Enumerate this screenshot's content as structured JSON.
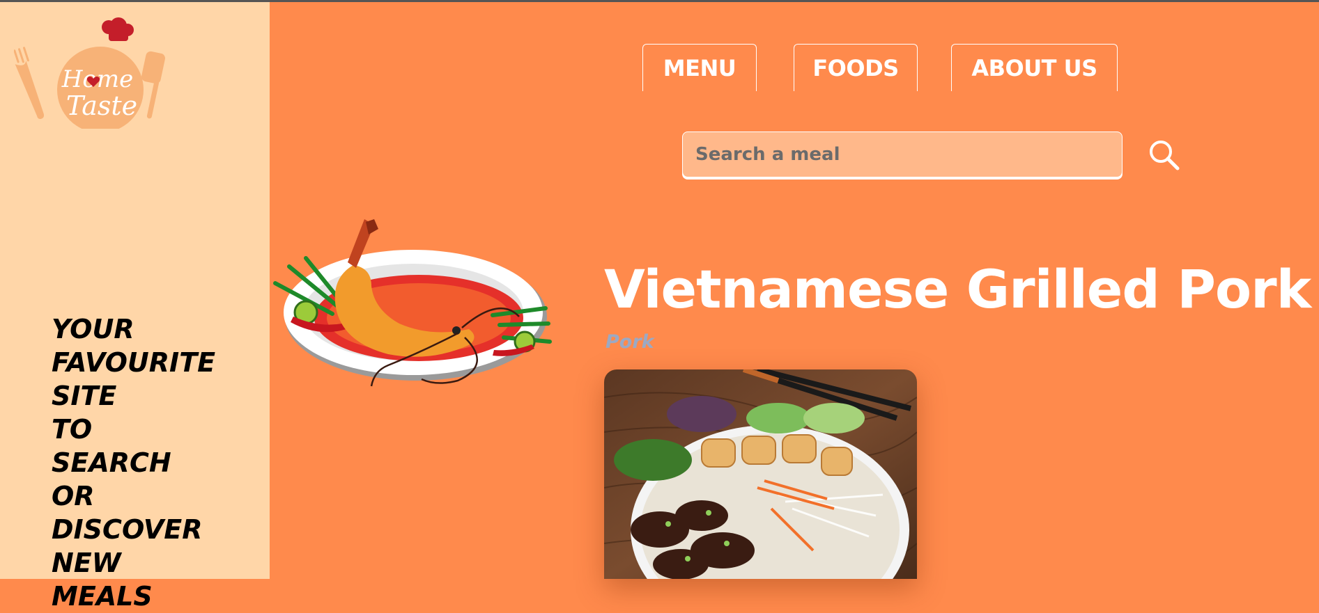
{
  "brand": {
    "logo_line1": "Home",
    "logo_line2": "Taste",
    "tagline": "YOUR FAVOURITE SITE TO SEARCH OR DISCOVER NEW MEALS"
  },
  "nav": {
    "items": [
      {
        "label": "MENU"
      },
      {
        "label": "FOODS"
      },
      {
        "label": "ABOUT US"
      }
    ]
  },
  "search": {
    "placeholder": "Search a meal",
    "value": ""
  },
  "meal": {
    "title": "Vietnamese Grilled Pork",
    "category": "Pork"
  },
  "icons": {
    "search": "search-icon"
  },
  "colors": {
    "main_bg": "#FF8A4C",
    "sidebar_bg": "#FFD6A8",
    "search_bg": "#FFB88A",
    "category_text": "#9BA9C4"
  }
}
